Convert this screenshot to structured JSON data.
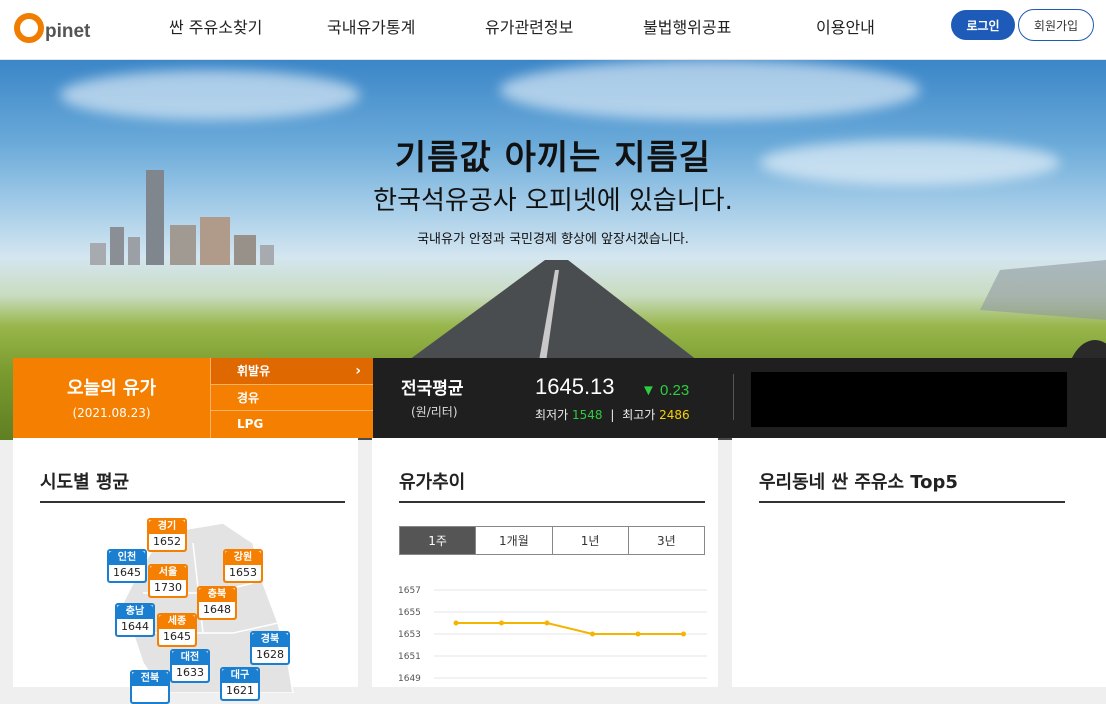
{
  "header": {
    "logo_text": "pinet",
    "nav": [
      "싼 주유소찾기",
      "국내유가통계",
      "유가관련정보",
      "불법행위공표",
      "이용안내"
    ],
    "login_label": "로그인",
    "join_label": "회원가입"
  },
  "hero": {
    "title": "기름값 아끼는 지름길",
    "subtitle": "한국석유공사 오피넷에 있습니다.",
    "tagline": "국내유가 안정과 국민경제 향상에 앞장서겠습니다."
  },
  "price_bar": {
    "today_label": "오늘의 유가",
    "today_date": "(2021.08.23)",
    "fuels": [
      "휘발유",
      "경유",
      "LPG"
    ],
    "active_fuel": "휘발유",
    "national_label": "전국평균",
    "national_unit": "(원/리터)",
    "national_price": "1645.13",
    "change_arrow": "▼",
    "change_value": "0.23",
    "min_label": "최저가",
    "min_value": "1548",
    "separator": "|",
    "max_label": "최고가",
    "max_value": "2486"
  },
  "regional": {
    "title": "시도별 평균",
    "regions": [
      {
        "name": "경기",
        "value": "1652",
        "color": "orange"
      },
      {
        "name": "인천",
        "value": "1645",
        "color": "blue"
      },
      {
        "name": "서울",
        "value": "1730",
        "color": "orange"
      },
      {
        "name": "강원",
        "value": "1653",
        "color": "orange"
      },
      {
        "name": "충북",
        "value": "1648",
        "color": "orange"
      },
      {
        "name": "충남",
        "value": "1644",
        "color": "blue"
      },
      {
        "name": "세종",
        "value": "1645",
        "color": "orange"
      },
      {
        "name": "경북",
        "value": "1628",
        "color": "blue"
      },
      {
        "name": "대전",
        "value": "1633",
        "color": "blue"
      },
      {
        "name": "대구",
        "value": "1621",
        "color": "blue"
      },
      {
        "name": "전북",
        "value": "",
        "color": "blue"
      }
    ]
  },
  "trend": {
    "title": "유가추이",
    "tabs": [
      "1주",
      "1개월",
      "1년",
      "3년"
    ],
    "active_tab": "1주",
    "chart_data": {
      "type": "line",
      "title": "",
      "xlabel": "",
      "ylabel": "",
      "x": [
        1,
        2,
        3,
        4,
        5,
        6
      ],
      "series": [
        {
          "values": [
            1654,
            1654,
            1654,
            1653,
            1653,
            1653
          ],
          "color": "#f5b400"
        }
      ],
      "ylim": [
        1649,
        1657
      ],
      "yticks": [
        1657,
        1655,
        1653,
        1651,
        1649
      ],
      "grid": true
    }
  },
  "top5": {
    "title": "우리동네 싼 주유소 Top5"
  }
}
